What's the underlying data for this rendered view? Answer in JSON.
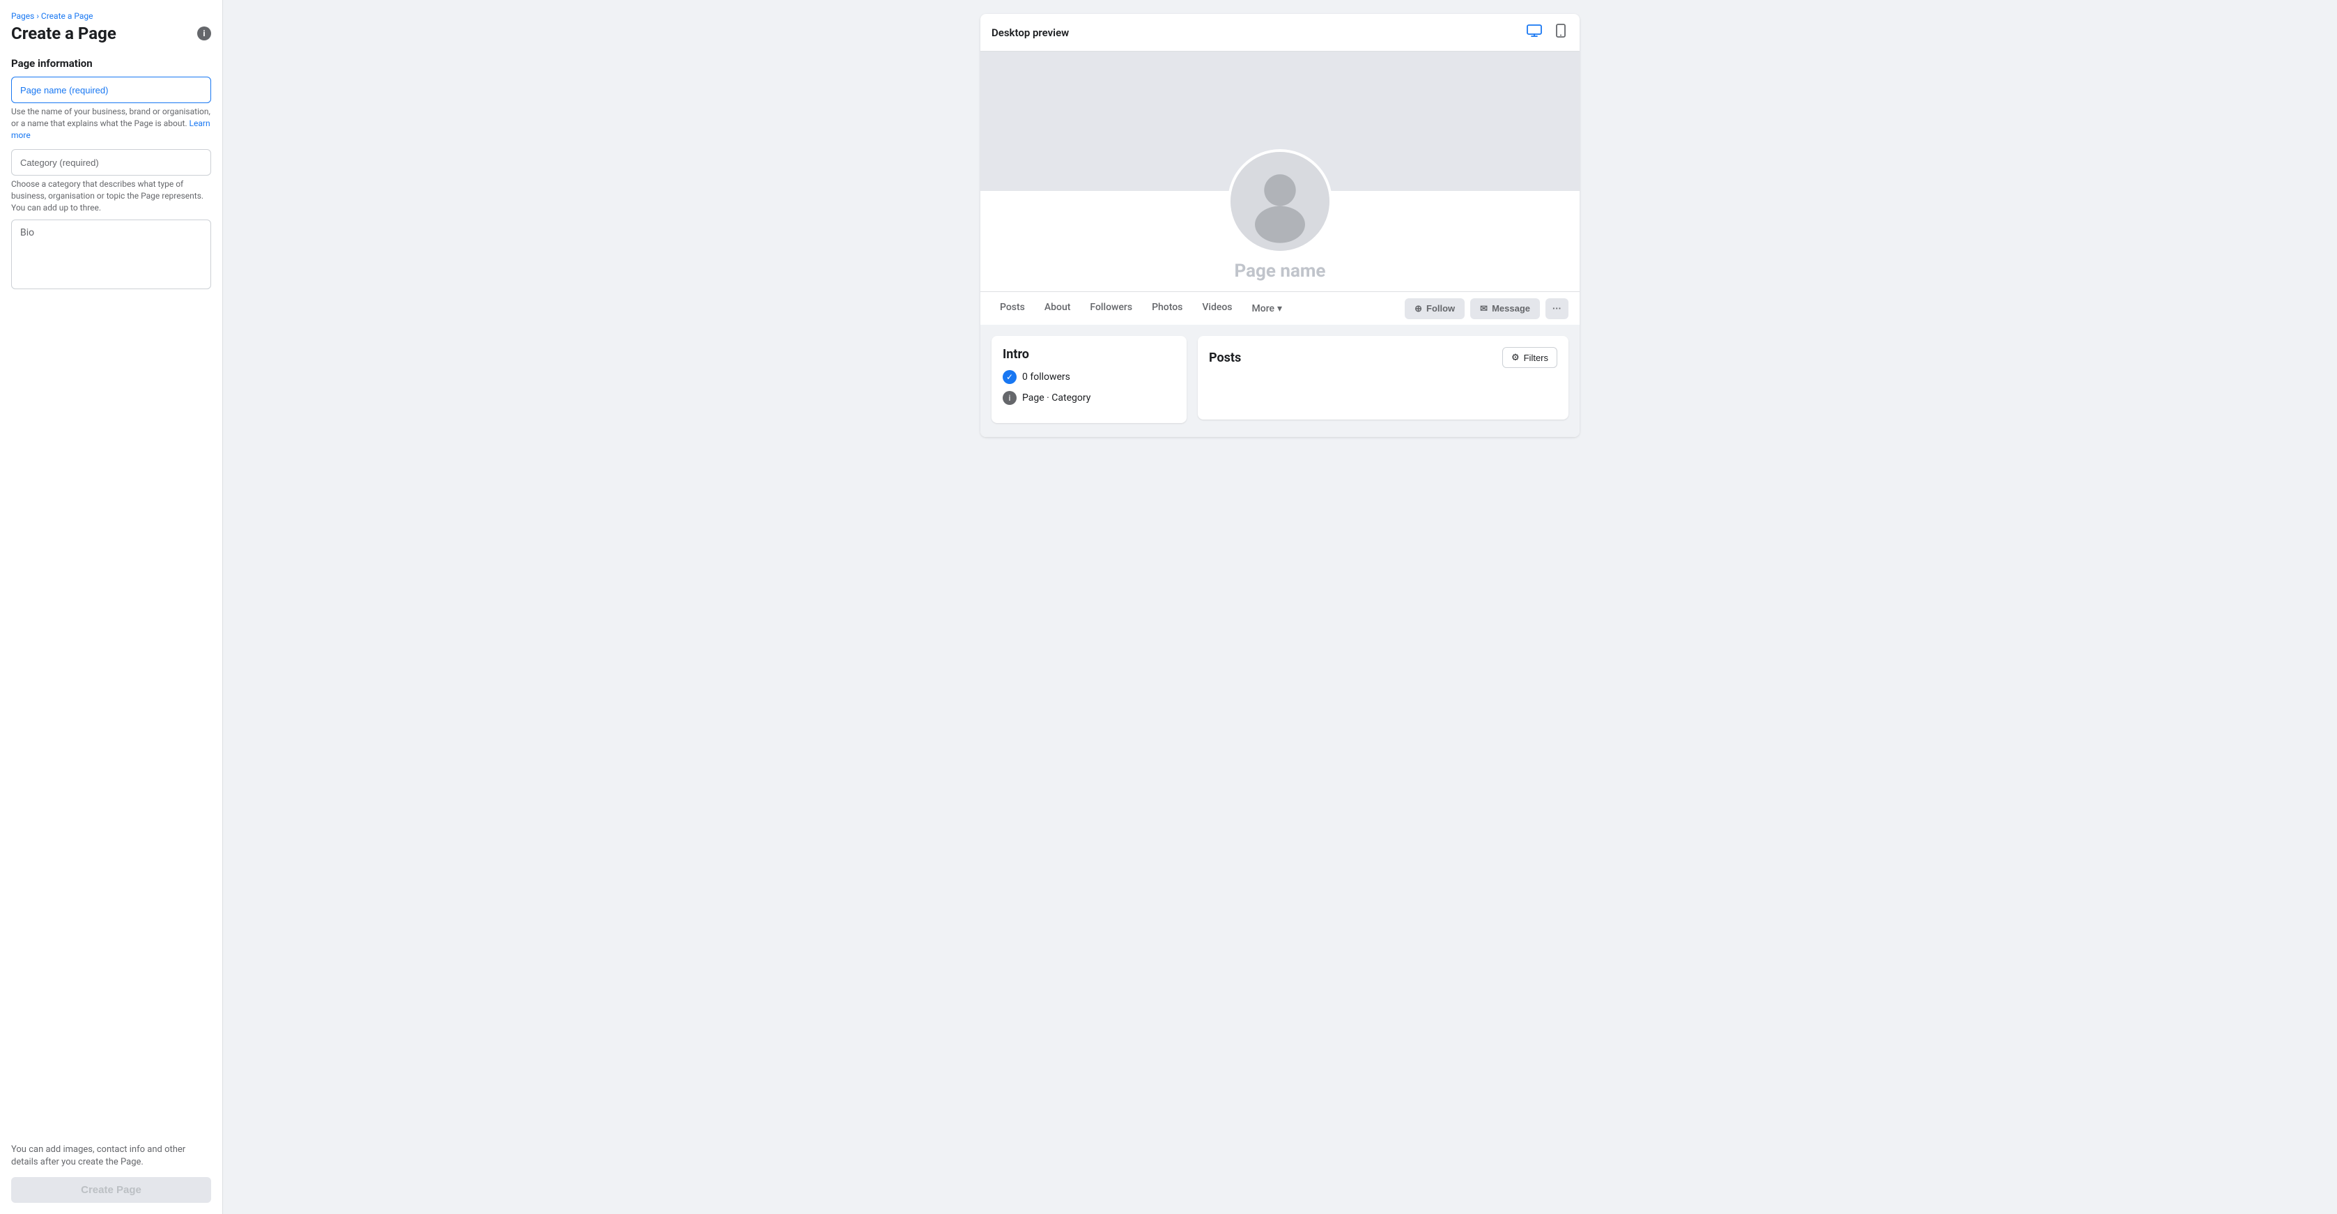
{
  "breadcrumb": {
    "parent": "Pages",
    "separator": "›",
    "current": "Create a Page"
  },
  "left_panel": {
    "title": "Create a Page",
    "info_icon": "i",
    "section_title": "Page information",
    "page_name_input": {
      "placeholder": "Page name (required)"
    },
    "page_name_helper": "Use the name of your business, brand or organisation, or a name that explains what the Page is about.",
    "learn_more": "Learn more",
    "category_input": {
      "placeholder": "Category (required)"
    },
    "category_helper": "Choose a category that describes what type of business, organisation or topic the Page represents. You can add up to three.",
    "bio_input": {
      "placeholder": "Bio"
    },
    "bottom_note": "You can add images, contact info and other details after you create the Page.",
    "create_button": "Create Page"
  },
  "preview": {
    "header_title": "Desktop preview",
    "icons": {
      "desktop": "🖥",
      "mobile": "📱"
    },
    "page_name_placeholder": "Page name",
    "nav_links": [
      {
        "label": "Posts"
      },
      {
        "label": "About"
      },
      {
        "label": "Followers"
      },
      {
        "label": "Photos"
      },
      {
        "label": "Videos"
      },
      {
        "label": "More"
      }
    ],
    "action_buttons": {
      "follow": "Follow",
      "message": "Message",
      "more": "···"
    },
    "intro": {
      "title": "Intro",
      "followers": "0 followers",
      "page_category": "Page · Category"
    },
    "posts": {
      "title": "Posts",
      "filters_label": "Filters"
    }
  }
}
